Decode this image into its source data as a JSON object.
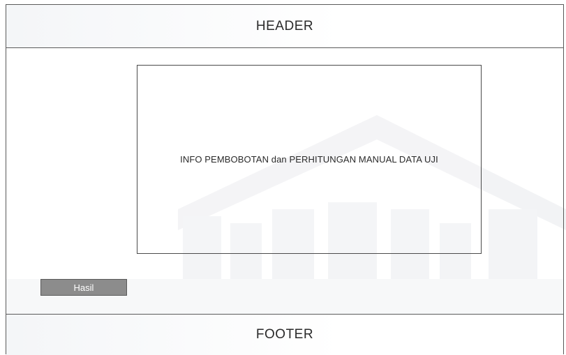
{
  "header": {
    "title": "HEADER"
  },
  "content": {
    "info_text": "INFO PEMBOBOTAN dan PERHITUNGAN MANUAL DATA UJI"
  },
  "actions": {
    "hasil_label": "Hasil"
  },
  "footer": {
    "title": "FOOTER"
  },
  "colors": {
    "border": "#5a5a5a",
    "button_bg": "#8c8c8c",
    "button_text": "#ffffff",
    "text": "#2a2a2a",
    "watermark": "#f0f1f3"
  }
}
